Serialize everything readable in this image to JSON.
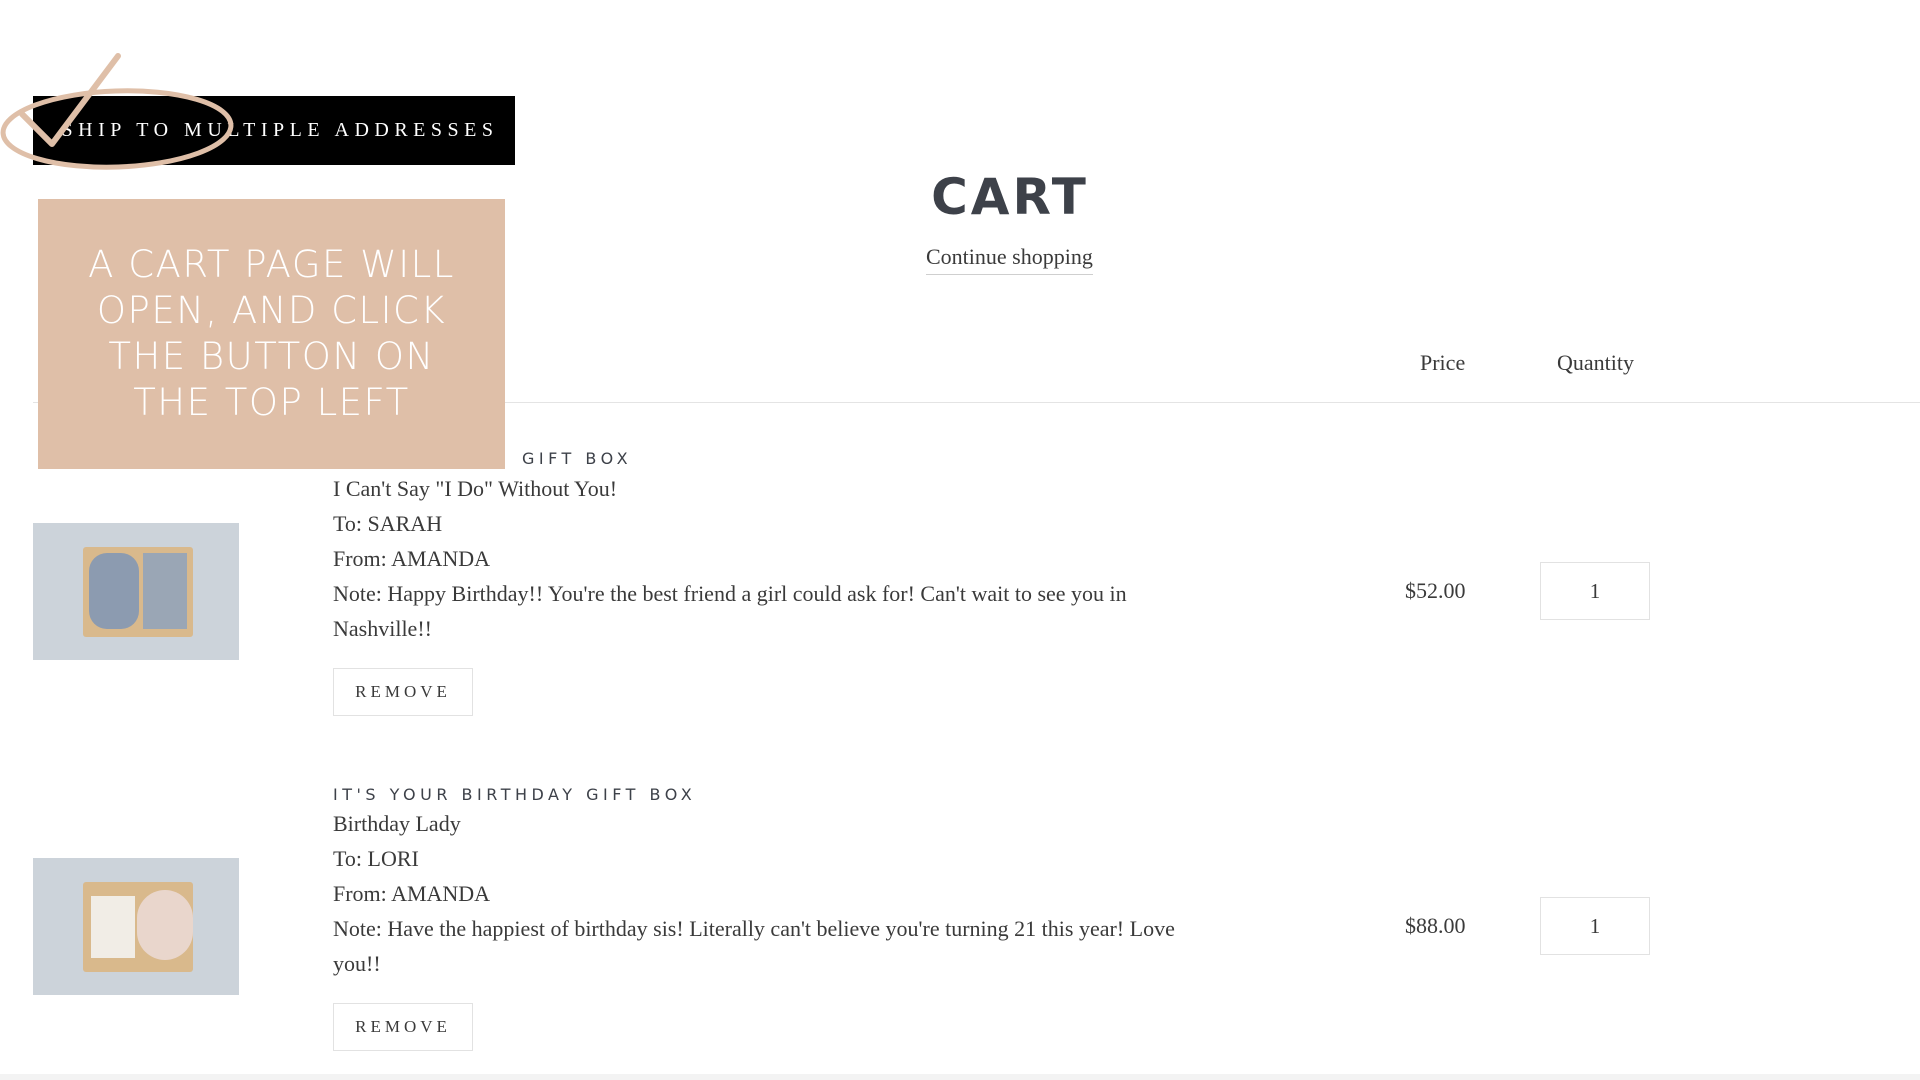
{
  "header": {
    "ship_button_label": "SHIP TO MULTIPLE ADDRESSES",
    "title": "CART",
    "continue_link": "Continue shopping"
  },
  "callout": {
    "text": "A CART PAGE WILL OPEN, AND CLICK THE BUTTON ON THE TOP LEFT",
    "background_color": "#dfbfa8"
  },
  "table": {
    "price_header": "Price",
    "quantity_header": "Quantity"
  },
  "items": [
    {
      "title": "I CAN'T SAY I DO WITHOUT YOU! GIFT BOX",
      "visible_title_fragment": "GIFT BOX",
      "thumbnail": "gift-box-scrunchie-photo",
      "props": [
        "I Can't Say \"I Do\" Without You!",
        "To: SARAH",
        "From: AMANDA",
        "Note: Happy Birthday!! You're the best friend a girl could ask for! Can't wait to see you in Nashville!!"
      ],
      "remove_label": "REMOVE",
      "price": "$52.00",
      "quantity": "1"
    },
    {
      "title": "IT'S YOUR BIRTHDAY GIFT BOX",
      "thumbnail": "birthday-gift-box-photo",
      "props": [
        "Birthday Lady",
        "To: LORI",
        "From: AMANDA",
        "Note: Have the happiest of birthday sis! Literally can't believe you're turning 21 this year! Love you!!"
      ],
      "remove_label": "REMOVE",
      "price": "$88.00",
      "quantity": "1"
    }
  ],
  "colors": {
    "accent_tan": "#dfbfa8",
    "text": "#3a3a3a",
    "button_black": "#000000"
  }
}
